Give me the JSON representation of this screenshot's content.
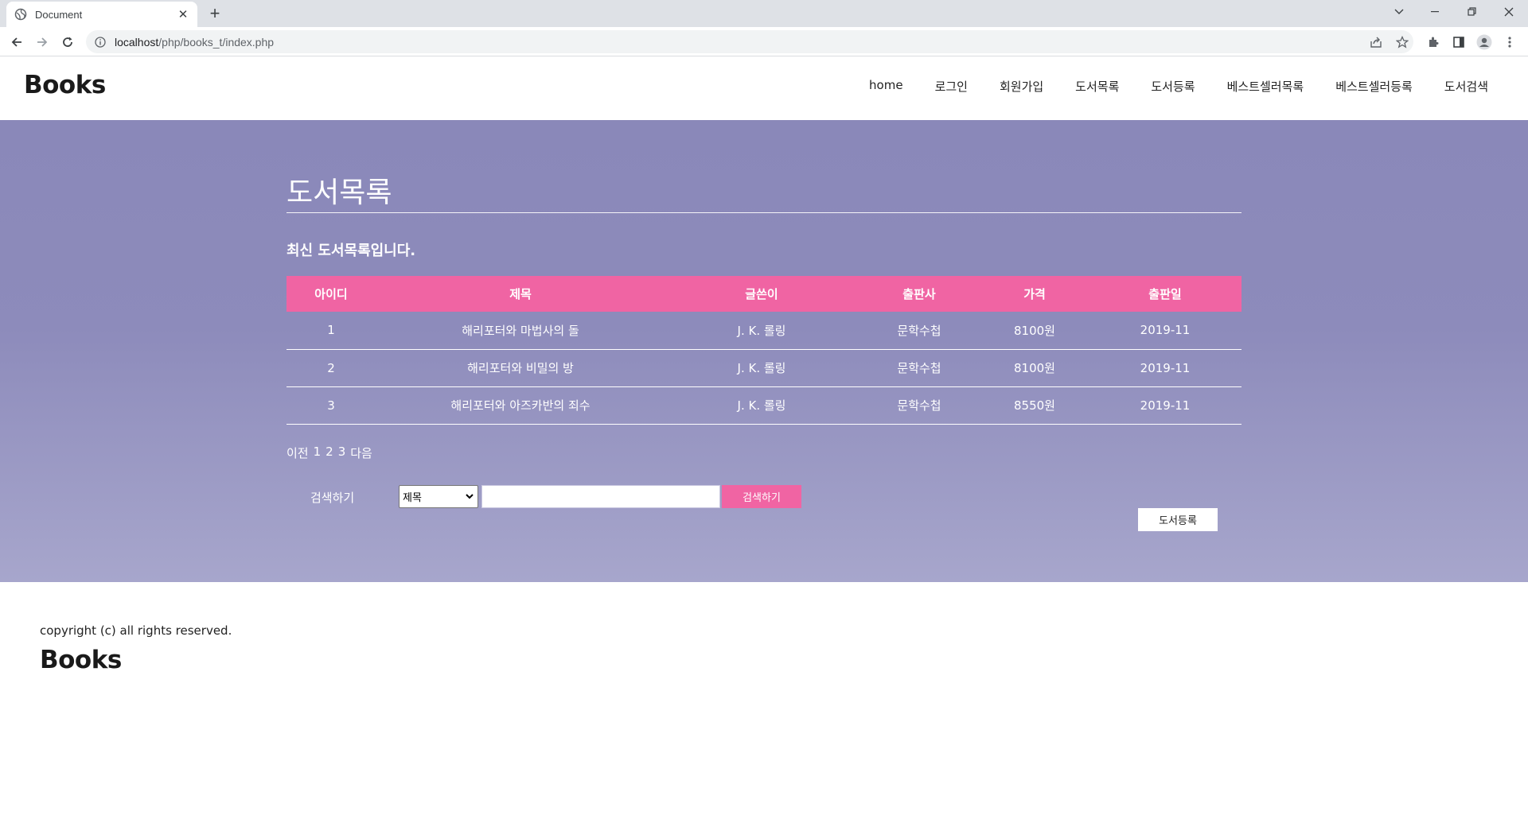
{
  "browser": {
    "tab_title": "Document",
    "url_host": "localhost",
    "url_path": "/php/books_t/index.php",
    "new_tab_label": "+"
  },
  "header": {
    "logo": "Books",
    "nav": [
      "home",
      "로그인",
      "회원가입",
      "도서목록",
      "도서등록",
      "베스트셀러목록",
      "베스트셀러등록",
      "도서검색"
    ]
  },
  "main": {
    "title": "도서목록",
    "subtitle": "최신 도서목록입니다.",
    "table": {
      "headers": [
        "아이디",
        "제목",
        "글쓴이",
        "출판사",
        "가격",
        "출판일"
      ],
      "rows": [
        [
          "1",
          "해리포터와 마법사의 돌",
          "J. K. 롤링",
          "문학수첩",
          "8100원",
          "2019-11"
        ],
        [
          "2",
          "해리포터와 비밀의 방",
          "J. K. 롤링",
          "문학수첩",
          "8100원",
          "2019-11"
        ],
        [
          "3",
          "해리포터와 아즈카반의 죄수",
          "J. K. 롤링",
          "문학수첩",
          "8550원",
          "2019-11"
        ]
      ]
    },
    "pager": {
      "prev": "이전",
      "pages": [
        "1",
        "2",
        "3"
      ],
      "next": "다음"
    },
    "search": {
      "label": "검색하기",
      "select_value": "제목",
      "input_value": "",
      "button": "검색하기"
    },
    "register_button": "도서등록"
  },
  "footer": {
    "copyright": "copyright (c) all rights reserved.",
    "logo": "Books"
  },
  "colors": {
    "accent": "#f064a3",
    "hero_top": "#8a88b9",
    "hero_bottom": "#a7a6cc"
  }
}
